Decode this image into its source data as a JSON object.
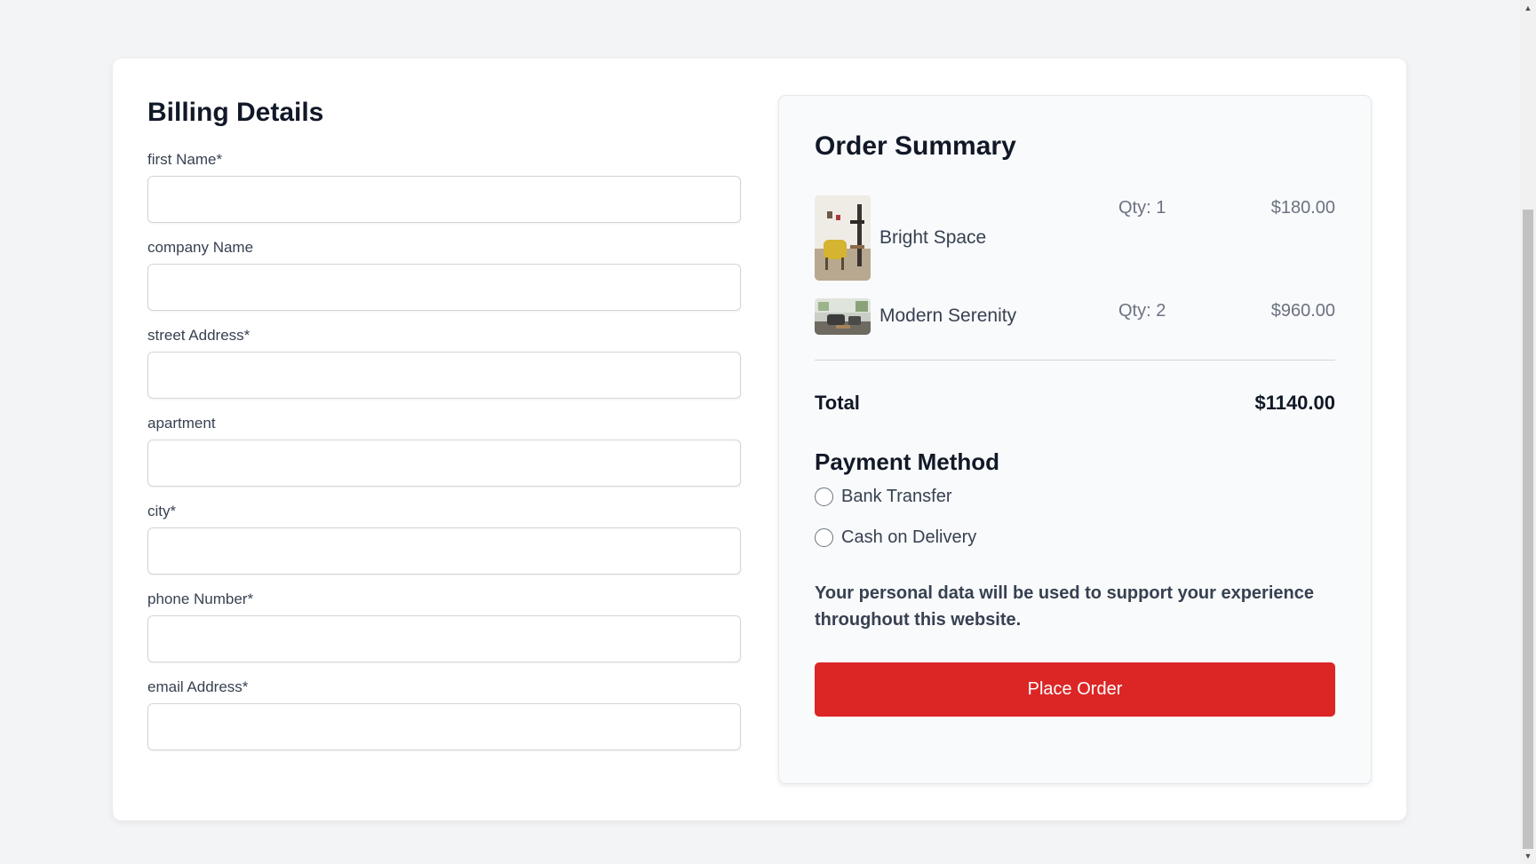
{
  "billing": {
    "title": "Billing Details",
    "fields": [
      {
        "label": "first Name*",
        "value": "",
        "placeholder": ""
      },
      {
        "label": "company Name",
        "value": "",
        "placeholder": ""
      },
      {
        "label": "street Address*",
        "value": "",
        "placeholder": ""
      },
      {
        "label": "apartment",
        "value": "",
        "placeholder": ""
      },
      {
        "label": "city*",
        "value": "",
        "placeholder": ""
      },
      {
        "label": "phone Number*",
        "value": "",
        "placeholder": ""
      },
      {
        "label": "email Address*",
        "value": "",
        "placeholder": ""
      }
    ]
  },
  "summary": {
    "title": "Order Summary",
    "items": [
      {
        "name": "Bright Space",
        "qty": "Qty: 1",
        "price": "$180.00",
        "image": "bright-space-thumbnail"
      },
      {
        "name": "Modern Serenity",
        "qty": "Qty: 2",
        "price": "$960.00",
        "image": "modern-serenity-thumbnail"
      }
    ],
    "total_label": "Total",
    "total_value": "$1140.00",
    "payment": {
      "title": "Payment Method",
      "options": [
        {
          "label": "Bank Transfer",
          "selected": false
        },
        {
          "label": "Cash on Delivery",
          "selected": false
        }
      ]
    },
    "privacy_text": "Your personal data will be used to support your experience throughout this website.",
    "place_order_label": "Place Order"
  },
  "colors": {
    "accent": "#dc2626",
    "background": "#f3f4f6",
    "card": "#ffffff",
    "summary_bg": "#f9fafb"
  }
}
